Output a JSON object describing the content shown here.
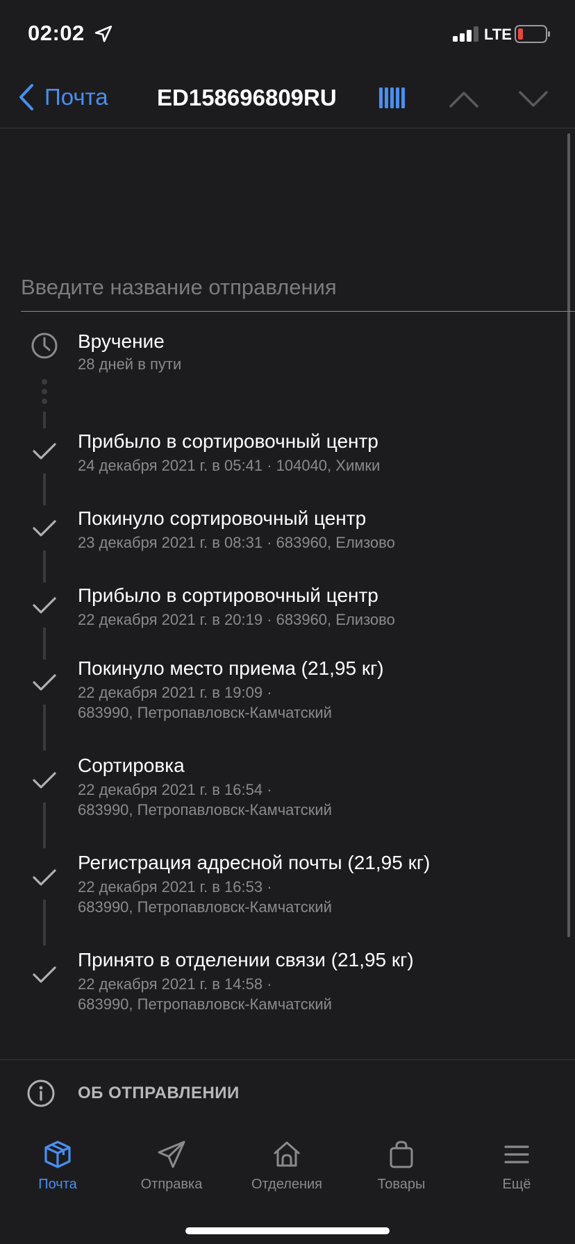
{
  "status_bar": {
    "time": "02:02",
    "network": "LTE"
  },
  "nav": {
    "back_label": "Почта",
    "title": "ED158696809RU"
  },
  "name_input": {
    "placeholder": "Введите название отправления"
  },
  "current_status": {
    "title": "Вручение",
    "subtitle": "28 дней в пути"
  },
  "events": [
    {
      "title": "Прибыло в сортировочный центр",
      "line1": "24 декабря 2021 г. в 05:41 · 104040, Химки",
      "line2": ""
    },
    {
      "title": "Покинуло сортировочный центр",
      "line1": "23 декабря 2021 г. в 08:31 · 683960, Елизово",
      "line2": ""
    },
    {
      "title": "Прибыло в сортировочный центр",
      "line1": "22 декабря 2021 г. в 20:19 · 683960, Елизово",
      "line2": ""
    },
    {
      "title": "Покинуло место приема  (21,95 кг)",
      "line1": "22 декабря 2021 г. в 19:09 ·",
      "line2": "683990, Петропавловск-Камчатский"
    },
    {
      "title": "Сортировка",
      "line1": "22 декабря 2021 г. в 16:54 ·",
      "line2": "683990, Петропавловск-Камчатский"
    },
    {
      "title": "Регистрация адресной почты  (21,95 кг)",
      "line1": "22 декабря 2021 г. в 16:53 ·",
      "line2": "683990, Петропавловск-Камчатский"
    },
    {
      "title": "Принято в отделении связи  (21,95 кг)",
      "line1": "22 декабря 2021 г. в 14:58 ·",
      "line2": "683990, Петропавловск-Камчатский"
    }
  ],
  "about": {
    "label": "ОБ ОТПРАВЛЕНИИ"
  },
  "tabs": [
    {
      "label": "Почта",
      "icon": "box-icon",
      "active": true
    },
    {
      "label": "Отправка",
      "icon": "send-icon",
      "active": false
    },
    {
      "label": "Отделения",
      "icon": "post-office-icon",
      "active": false
    },
    {
      "label": "Товары",
      "icon": "shopping-bag-icon",
      "active": false
    },
    {
      "label": "Ещё",
      "icon": "menu-icon",
      "active": false
    }
  ],
  "colors": {
    "background": "#1c1c1e",
    "accent": "#4a8ff0",
    "secondary_text": "#8a8a8e",
    "battery_low": "#e5483f"
  }
}
